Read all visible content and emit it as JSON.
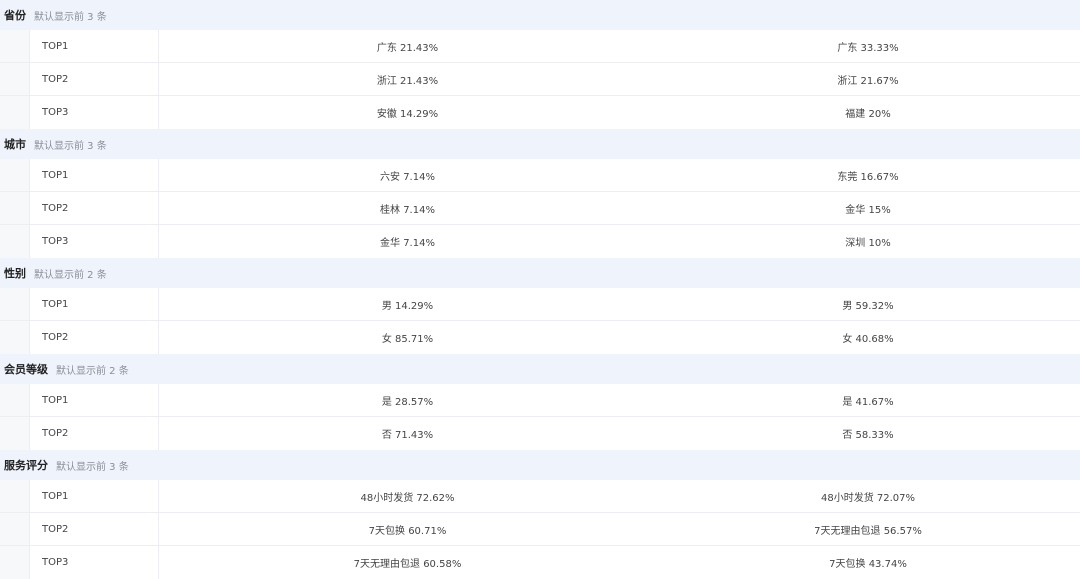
{
  "sections": [
    {
      "title": "省份",
      "note": "默认显示前 3 条",
      "rows": [
        {
          "rank": "TOP1",
          "left": "广东 21.43%",
          "right": "广东 33.33%"
        },
        {
          "rank": "TOP2",
          "left": "浙江 21.43%",
          "right": "浙江 21.67%"
        },
        {
          "rank": "TOP3",
          "left": "安徽 14.29%",
          "right": "福建 20%"
        }
      ]
    },
    {
      "title": "城市",
      "note": "默认显示前 3 条",
      "rows": [
        {
          "rank": "TOP1",
          "left": "六安 7.14%",
          "right": "东莞 16.67%"
        },
        {
          "rank": "TOP2",
          "left": "桂林 7.14%",
          "right": "金华 15%"
        },
        {
          "rank": "TOP3",
          "left": "金华 7.14%",
          "right": "深圳 10%"
        }
      ]
    },
    {
      "title": "性别",
      "note": "默认显示前 2 条",
      "rows": [
        {
          "rank": "TOP1",
          "left": "男 14.29%",
          "right": "男 59.32%"
        },
        {
          "rank": "TOP2",
          "left": "女 85.71%",
          "right": "女 40.68%"
        }
      ]
    },
    {
      "title": "会员等级",
      "note": "默认显示前 2 条",
      "rows": [
        {
          "rank": "TOP1",
          "left": "是 28.57%",
          "right": "是 41.67%"
        },
        {
          "rank": "TOP2",
          "left": "否 71.43%",
          "right": "否 58.33%"
        }
      ]
    },
    {
      "title": "服务评分",
      "note": "默认显示前 3 条",
      "rows": [
        {
          "rank": "TOP1",
          "left": "48小时发货 72.62%",
          "right": "48小时发货 72.07%"
        },
        {
          "rank": "TOP2",
          "left": "7天包换 60.71%",
          "right": "7天无理由包退 56.57%"
        },
        {
          "rank": "TOP3",
          "left": "7天无理由包退 60.58%",
          "right": "7天包换 43.74%"
        }
      ]
    }
  ]
}
